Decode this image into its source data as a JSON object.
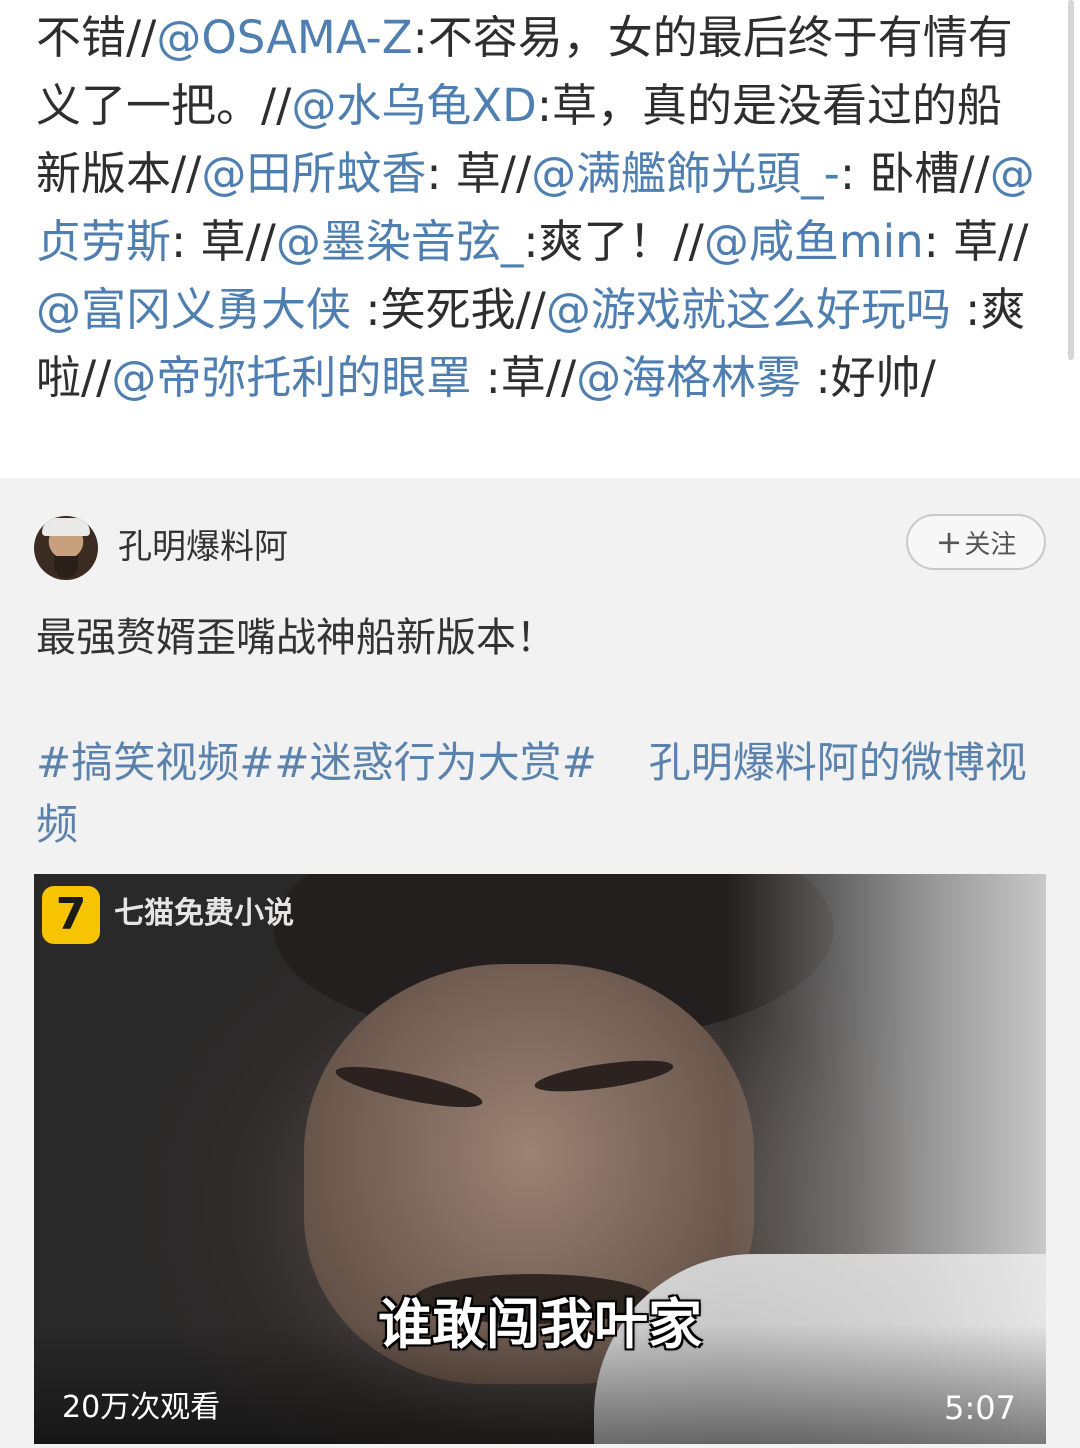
{
  "repost": {
    "segments": [
      {
        "text": "不错//",
        "mention": false
      },
      {
        "text": "@OSAMA-Z",
        "mention": true
      },
      {
        "text": ":不容易，女的最后终于有情有义了一把。//",
        "mention": false
      },
      {
        "text": "@水乌龟XD",
        "mention": true
      },
      {
        "text": ":草，真的是没看过的船新版本//",
        "mention": false
      },
      {
        "text": "@田所蚊香",
        "mention": true
      },
      {
        "text": ": 草//",
        "mention": false
      },
      {
        "text": "@满艦飾光頭_-",
        "mention": true
      },
      {
        "text": ": 卧槽//",
        "mention": false
      },
      {
        "text": "@贞劳斯",
        "mention": true
      },
      {
        "text": ": 草//",
        "mention": false
      },
      {
        "text": "@墨染音弦_",
        "mention": true
      },
      {
        "text": ":爽了！//",
        "mention": false
      },
      {
        "text": "@咸鱼min",
        "mention": true
      },
      {
        "text": ": 草//",
        "mention": false
      },
      {
        "text": "@富冈义勇大侠",
        "mention": true
      },
      {
        "text": " :笑死我//",
        "mention": false
      },
      {
        "text": "@游戏就这么好玩吗",
        "mention": true
      },
      {
        "text": " :爽啦//",
        "mention": false
      },
      {
        "text": "@帝弥托利的眼罩",
        "mention": true
      },
      {
        "text": " :草//",
        "mention": false
      },
      {
        "text": "@海格林雾",
        "mention": true
      },
      {
        "text": " :好帅/",
        "mention": false
      }
    ]
  },
  "original_post": {
    "author": {
      "name": "孔明爆料阿",
      "follow_label": "关注",
      "follow_prefix": "+"
    },
    "text": "最强赘婿歪嘴战神船新版本！",
    "topics": {
      "topic_1": "#搞笑视频#",
      "topic_2": "#迷惑行为大赏#",
      "video_link": "孔明爆料阿的微博视频"
    },
    "video": {
      "app_logo_glyph": "7",
      "app_name": "七猫免费小说",
      "subtitle": "谁敢闯我叶家",
      "views": "20万次观看",
      "duration": "5:07"
    }
  },
  "colors": {
    "mention": "#4f7fb0",
    "topic": "#5a82ad",
    "original_bg": "#f2f2f2",
    "text": "#2e2e2e"
  },
  "icons": {
    "avatar": "avatar",
    "app_logo": "qimao-logo-icon"
  }
}
